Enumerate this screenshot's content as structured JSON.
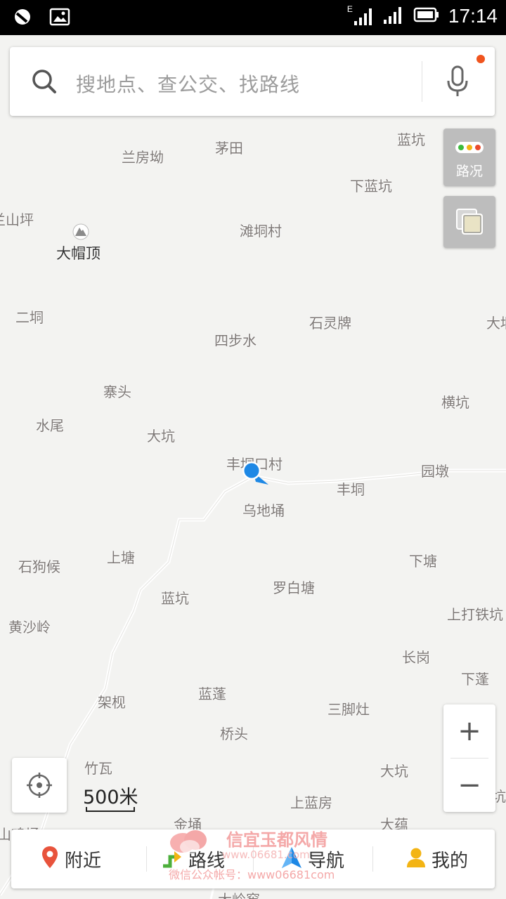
{
  "status_bar": {
    "time": "17:14",
    "network_badge": "E"
  },
  "search": {
    "placeholder": "搜地点、查公交、找路线"
  },
  "controls": {
    "traffic_label": "路况",
    "zoom_in": "+",
    "zoom_out": "−",
    "scale": "500米"
  },
  "map": {
    "current_location_label": "丰垌口村",
    "places": [
      {
        "name": "兰房坳"
      },
      {
        "name": "茅田"
      },
      {
        "name": "蓝坑"
      },
      {
        "name": "下蓝坑"
      },
      {
        "name": "兰山坪"
      },
      {
        "name": "滩垌村"
      },
      {
        "name": "大帽顶"
      },
      {
        "name": "二垌"
      },
      {
        "name": "石灵牌"
      },
      {
        "name": "大垌"
      },
      {
        "name": "四步水"
      },
      {
        "name": "寨头"
      },
      {
        "name": "横坑"
      },
      {
        "name": "水尾"
      },
      {
        "name": "大坑"
      },
      {
        "name": "丰垌口村"
      },
      {
        "name": "园墩"
      },
      {
        "name": "丰垌"
      },
      {
        "name": "乌地埇"
      },
      {
        "name": "上塘"
      },
      {
        "name": "石狗候"
      },
      {
        "name": "下塘"
      },
      {
        "name": "罗白塘"
      },
      {
        "name": "蓝坑"
      },
      {
        "name": "上打铁坑"
      },
      {
        "name": "黄沙岭"
      },
      {
        "name": "长岗"
      },
      {
        "name": "下蓬"
      },
      {
        "name": "架枧"
      },
      {
        "name": "蓝蓬"
      },
      {
        "name": "三脚灶"
      },
      {
        "name": "桥头"
      },
      {
        "name": "竹瓦"
      },
      {
        "name": "大坑"
      },
      {
        "name": "上蓝房"
      },
      {
        "name": "金埇"
      },
      {
        "name": "大蕴"
      },
      {
        "name": "山鸡埇"
      },
      {
        "name": "大岭窖"
      },
      {
        "name": "坑"
      }
    ]
  },
  "bottom_nav": {
    "nearby": "附近",
    "route": "路线",
    "navigate": "导航",
    "mine": "我的"
  },
  "watermark": {
    "title": "信宜玉都风情",
    "url": "www.06681.com",
    "subtitle": "微信公众帐号：www06681com"
  },
  "colors": {
    "map_bg": "#f3f3f1",
    "accent_blue": "#1e88e5",
    "pin_red": "#e8533c",
    "traffic_green": "#3cbb3c",
    "traffic_yellow": "#f3b414",
    "traffic_red": "#ea4b2d"
  }
}
